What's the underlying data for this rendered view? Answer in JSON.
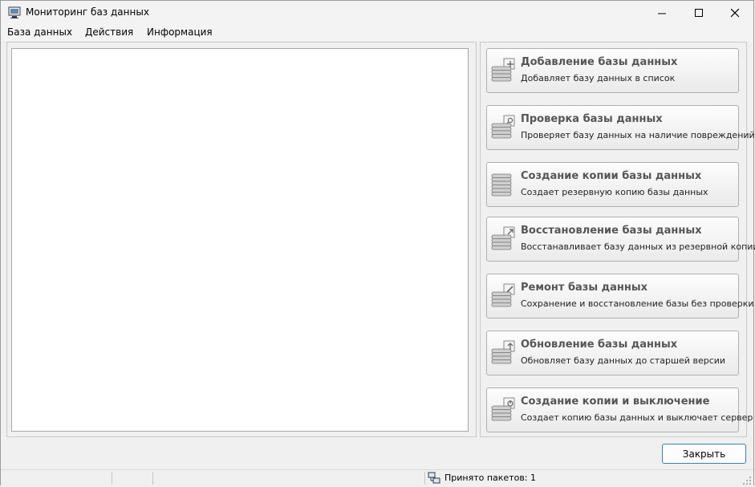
{
  "window": {
    "title": "Мониторинг баз данных"
  },
  "menu": {
    "items": [
      "База данных",
      "Действия",
      "Информация"
    ]
  },
  "actions": [
    {
      "title": "Добавление базы данных",
      "desc": "Добавляет базу данных в список",
      "overlay": "plus"
    },
    {
      "title": "Проверка базы данных",
      "desc": "Проверяет базу данных на наличие повреждений",
      "overlay": "search"
    },
    {
      "title": "Создание копии базы данных",
      "desc": "Создает резервную копию базы данных",
      "overlay": "none"
    },
    {
      "title": "Восстановление базы данных",
      "desc": "Восстанавливает базу данных из резервной копии",
      "overlay": "restore"
    },
    {
      "title": "Ремонт базы данных",
      "desc": "Сохранение и восстановление базы без проверки",
      "overlay": "wrench"
    },
    {
      "title": "Обновление базы данных",
      "desc": "Обновляет базу данных до старшей версии",
      "overlay": "up"
    },
    {
      "title": "Создание копии и выключение",
      "desc": "Создает копию базы данных и выключает сервер",
      "overlay": "power"
    }
  ],
  "footer": {
    "close_label": "Закрыть"
  },
  "statusbar": {
    "packets": "Принято пакетов: 1"
  },
  "colors": {
    "accent_border": "#3c7fb1",
    "button_title": "#555555"
  }
}
